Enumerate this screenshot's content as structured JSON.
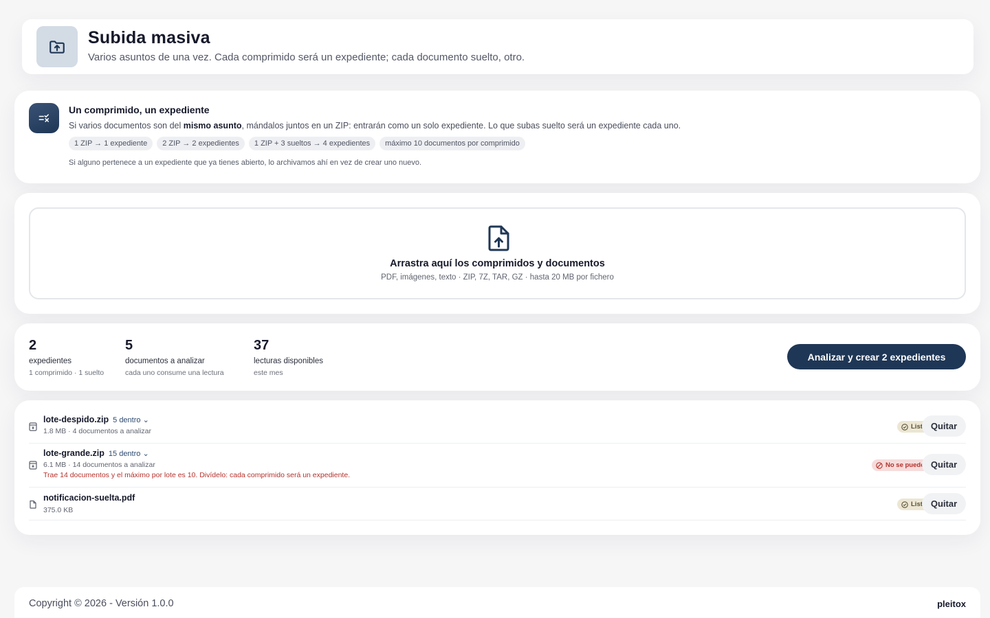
{
  "header": {
    "title": "Subida masiva",
    "subtitle": "Varios asuntos de una vez. Cada comprimido será un expediente; cada documento suelto, otro.",
    "icon": "folder-upload-icon"
  },
  "info": {
    "icon": "sort-check-icon",
    "title": "Un comprimido, un expediente",
    "desc_before": "Si varios documentos son del ",
    "desc_bold": "mismo asunto",
    "desc_after": ", mándalos juntos en un ZIP: entrarán como un solo expediente. Lo que subas suelto será un expediente cada uno.",
    "chips": [
      "1 ZIP → 1 expediente",
      "2 ZIP → 2 expedientes",
      "1 ZIP + 3 sueltos → 4 expedientes",
      "máximo 10 documentos por comprimido"
    ],
    "note": "Si alguno pertenece a un expediente que ya tienes abierto, lo archivamos ahí en vez de crear uno nuevo."
  },
  "dropzone": {
    "icon": "file-upload-icon",
    "title": "Arrastra aquí los comprimidos y documentos",
    "subtitle": "PDF, imágenes, texto · ZIP, 7Z, TAR, GZ · hasta 20 MB por fichero"
  },
  "stats": [
    {
      "value": "2",
      "label": "expedientes",
      "sub": "1 comprimido · 1 suelto"
    },
    {
      "value": "5",
      "label": "documentos a analizar",
      "sub": "cada uno consume una lectura"
    },
    {
      "value": "37",
      "label": "lecturas disponibles",
      "sub": "este mes"
    }
  ],
  "primary_button": "Analizar y crear 2 expedientes",
  "files": [
    {
      "name": "lote-despido.zip",
      "inside": "5 dentro",
      "meta": "1.8 MB · 4 documentos a analizar",
      "error": "",
      "status": "Listo",
      "status_type": "ok",
      "remove": "Quitar",
      "icon": "archive-icon"
    },
    {
      "name": "lote-grande.zip",
      "inside": "15 dentro",
      "meta": "6.1 MB · 14 documentos a analizar",
      "error": "Trae 14 documentos y el máximo por lote es 10. Divídelo: cada comprimido será un expediente.",
      "status": "No se puede",
      "status_type": "error",
      "remove": "Quitar",
      "icon": "archive-icon"
    },
    {
      "name": "notificacion-suelta.pdf",
      "inside": "",
      "meta": "375.0 KB",
      "error": "",
      "status": "Listo",
      "status_type": "ok",
      "remove": "Quitar",
      "icon": "document-icon"
    }
  ],
  "footer": {
    "copyright": "Copyright © 2026 - Versión 1.0.0",
    "brand": "pleitox"
  },
  "colors": {
    "primary": "#1f3756",
    "error": "#b3322c",
    "ok_badge": "#ece6d3",
    "error_badge": "#f6dcdb"
  }
}
